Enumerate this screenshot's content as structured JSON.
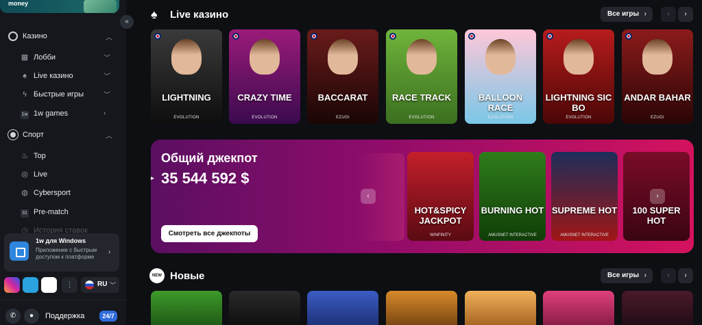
{
  "sidebar": {
    "promo_text": "money",
    "casino": {
      "label": "Казино",
      "items": [
        {
          "label": "Лобби",
          "icon": "grid-icon"
        },
        {
          "label": "Live казино",
          "icon": "spade-icon"
        },
        {
          "label": "Быстрые игры",
          "icon": "bolt-icon"
        },
        {
          "label": "1w games",
          "icon": "1w-icon",
          "icon_text": "1w"
        }
      ]
    },
    "sport": {
      "label": "Спорт",
      "items": [
        {
          "label": "Top",
          "icon": "flame-icon"
        },
        {
          "label": "Live",
          "icon": "live-icon"
        },
        {
          "label": "Cybersport",
          "icon": "gamepad-icon"
        },
        {
          "label": "Pre-match",
          "icon": "calendar-icon",
          "icon_text": "31"
        },
        {
          "label": "История ставок",
          "icon": "history-icon"
        }
      ]
    },
    "windows_card": {
      "title": "1w для Windows",
      "desc": "Приложение с быстрым доступом к платформе"
    },
    "lang": "RU",
    "support": "Поддержка",
    "support_badge": "24/7"
  },
  "live": {
    "title": "Live казино",
    "all_label": "Все игры",
    "cards": [
      {
        "title": "LIGHTNING",
        "provider": "EVOLUTION",
        "color_a": "#3a3a3a",
        "color_b": "#0e0e0e"
      },
      {
        "title": "CRAZY TIME",
        "provider": "EVOLUTION",
        "color_a": "#9b1b7a",
        "color_b": "#3b0a4e"
      },
      {
        "title": "BACCARAT",
        "provider": "EZUGI",
        "color_a": "#6a1b1b",
        "color_b": "#1a0505"
      },
      {
        "title": "RACE TRACK",
        "provider": "EVOLUTION",
        "color_a": "#6fb43b",
        "color_b": "#3b6f1f"
      },
      {
        "title": "BALLOON RACE",
        "provider": "EVOLUTION",
        "color_a": "#ffc7d8",
        "color_b": "#7ac7e8"
      },
      {
        "title": "LIGHTNING SIC BO",
        "provider": "EVOLUTION",
        "color_a": "#b71c1c",
        "color_b": "#4a0606"
      },
      {
        "title": "ANDAR BAHAR",
        "provider": "EZUGI",
        "color_a": "#8c1b1b",
        "color_b": "#2a0505"
      }
    ]
  },
  "jackpot": {
    "title": "Общий джекпот",
    "amount": "35 544 592 $",
    "button": "Смотреть все джекпоты",
    "cards": [
      {
        "title": "HOT&SPICY JACKPOT",
        "provider": "WINFINITY",
        "color_a": "#c41f2b",
        "color_b": "#5a0a12"
      },
      {
        "title": "BURNING HOT",
        "provider": "AMUSNET INTERACTIVE",
        "color_a": "#2f7d1b",
        "color_b": "#103d08"
      },
      {
        "title": "SUPREME HOT",
        "provider": "AMUSNET INTERACTIVE",
        "color_a": "#1d2d5a",
        "color_b": "#a01616"
      },
      {
        "title": "100 SUPER HOT",
        "provider": "",
        "color_a": "#7a0c28",
        "color_b": "#3a0512"
      }
    ]
  },
  "new": {
    "badge": "NEW",
    "title": "Новые",
    "all_label": "Все игры",
    "cards": [
      {
        "color_a": "#3d9a2a",
        "color_b": "#1c4f13"
      },
      {
        "color_a": "#2a2a2a",
        "color_b": "#0a0a0a"
      },
      {
        "color_a": "#3b5cc4",
        "color_b": "#1a2b6b"
      },
      {
        "color_a": "#d88a2a",
        "color_b": "#6a3a0e"
      },
      {
        "color_a": "#f0b05a",
        "color_b": "#9a5a1a"
      },
      {
        "color_a": "#e0407a",
        "color_b": "#7a1640"
      },
      {
        "color_a": "#4a1a2a",
        "color_b": "#1a0a12"
      }
    ]
  }
}
